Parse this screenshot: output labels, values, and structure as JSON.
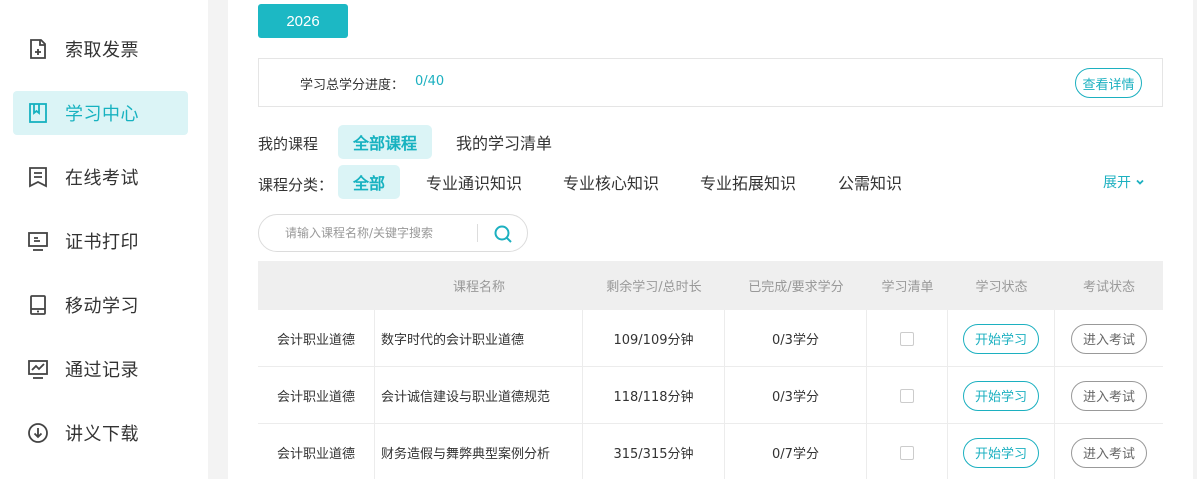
{
  "sidebar": {
    "items": [
      {
        "label": "索取发票",
        "icon": "invoice-icon",
        "active": false
      },
      {
        "label": "学习中心",
        "icon": "book-icon",
        "active": true
      },
      {
        "label": "在线考试",
        "icon": "exam-icon",
        "active": false
      },
      {
        "label": "证书打印",
        "icon": "monitor-icon",
        "active": false
      },
      {
        "label": "移动学习",
        "icon": "tablet-icon",
        "active": false
      },
      {
        "label": "通过记录",
        "icon": "chart-icon",
        "active": false
      },
      {
        "label": "讲义下载",
        "icon": "download-icon",
        "active": false
      }
    ]
  },
  "main": {
    "year": "2026",
    "progress": {
      "label": "学习总学分进度：",
      "value": "0/40",
      "detail_button": "查看详情"
    },
    "my_courses": {
      "label": "我的课程",
      "tabs": [
        "全部课程",
        "我的学习清单"
      ]
    },
    "category": {
      "label": "课程分类：",
      "tabs": [
        "全部",
        "专业通识知识",
        "专业核心知识",
        "专业拓展知识",
        "公需知识"
      ],
      "expand": "展开"
    },
    "search": {
      "placeholder": "请输入课程名称/关键字搜索"
    },
    "table": {
      "headers": [
        "",
        "课程名称",
        "剩余学习/总时长",
        "已完成/要求学分",
        "学习清单",
        "学习状态",
        "考试状态"
      ],
      "rows": [
        {
          "category": "会计职业道德",
          "name": "数字时代的会计职业道德",
          "duration": "109/109分钟",
          "credits": "0/3学分",
          "start": "开始学习",
          "exam": "进入考试"
        },
        {
          "category": "会计职业道德",
          "name": "会计诚信建设与职业道德规范",
          "duration": "118/118分钟",
          "credits": "0/3学分",
          "start": "开始学习",
          "exam": "进入考试"
        },
        {
          "category": "会计职业道德",
          "name": "财务造假与舞弊典型案例分析",
          "duration": "315/315分钟",
          "credits": "0/7学分",
          "start": "开始学习",
          "exam": "进入考试"
        }
      ]
    }
  },
  "colors": {
    "accent": "#1cb8c4",
    "accent_light": "#dbf4f6"
  }
}
